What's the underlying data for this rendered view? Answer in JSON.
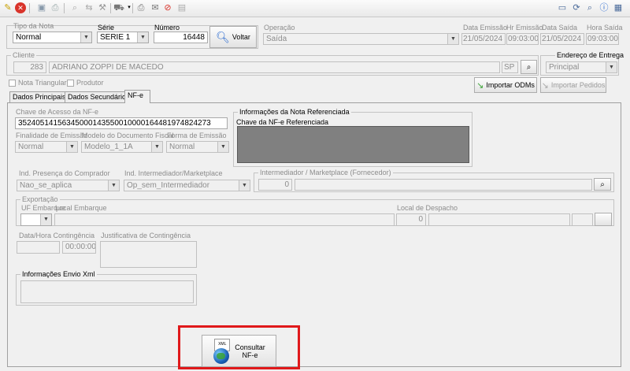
{
  "colors": {
    "highlight_box": "#e0191b",
    "disabled_text": "#8c8c8c",
    "textarea_dark": "#808080"
  },
  "toolbar": {
    "icons": [
      "pencil-icon",
      "cancel-icon",
      "save-icon",
      "print-icon",
      "search-icon",
      "transfer-icon",
      "tools-icon",
      "car-icon",
      "printer-icon",
      "email-icon",
      "block-icon",
      "list-icon",
      "window-icon",
      "refresh-icon",
      "search2-icon",
      "info-icon",
      "grid-icon"
    ]
  },
  "header": {
    "tipo_nota_label": "Tipo da Nota",
    "tipo_nota_value": "Normal",
    "serie_label": "Série",
    "serie_value": "SERIE 1",
    "numero_label": "Número",
    "numero_value": "16448",
    "voltar_label": "Voltar",
    "operacao_label": "Operação",
    "operacao_value": "Saída",
    "data_emissao_label": "Data Emissão",
    "data_emissao_value": "21/05/2024",
    "hr_emissao_label": "Hr Emissão",
    "hr_emissao_value": "09:03:00",
    "data_saida_label": "Data Saída",
    "data_saida_value": "21/05/2024",
    "hora_saida_label": "Hora Saída",
    "hora_saida_value": "09:03:00"
  },
  "cliente": {
    "label": "Cliente",
    "code": "283",
    "name": "ADRIANO ZOPPI DE MACEDO",
    "uf": "SP"
  },
  "endereco": {
    "label": "Endereço de Entrega",
    "value": "Principal"
  },
  "options": {
    "nota_triangular": "Nota Triangular",
    "produtor": "Produtor"
  },
  "buttons": {
    "importar_odms": "Importar ODMs",
    "importar_pedidos": "Importar Pedidos",
    "consultar_line1": "Consultar",
    "consultar_line2": "NF-e",
    "xml_tag": "XML"
  },
  "tabs": [
    {
      "label": "Dados Principais"
    },
    {
      "label": "Dados Secundários"
    },
    {
      "label": "NF-e"
    }
  ],
  "nfe": {
    "chave_label": "Chave de Acesso da NF-e",
    "chave_value": "35240514156345000143550010000164481974824273",
    "finalidade_label": "Finalidade de Emissão",
    "finalidade_value": "Normal",
    "modelo_label": "Modelo do Documento Fiscal",
    "modelo_value": "Modelo_1_1A",
    "forma_label": "Forma de Emissão",
    "forma_value": "Normal",
    "info_ref_label": "Informações da Nota Referenciada",
    "chave_ref_label": "Chave da NF-e Referenciada",
    "presenca_label": "Ind. Presença do Comprador",
    "presenca_value": "Nao_se_aplica",
    "intermediador_label": "Ind. Intermediador/Marketplace",
    "intermediador_value": "Op_sem_Intermediador",
    "intermed_group_label": "Intermediador / Marketplace (Fornecedor)",
    "intermed_code": "0",
    "exportacao_label": "Exportação",
    "uf_embarque_label": "UF Embarque",
    "local_embarque_label": "Local Embarque",
    "local_despacho_label": "Local de Despacho",
    "local_despacho_code": "0",
    "contingencia_label": "Data/Hora Contingência",
    "contingencia_time": "00:00:00",
    "justificativa_label": "Justificativa de Contingência",
    "envio_xml_label": "Informações Envio Xml"
  }
}
